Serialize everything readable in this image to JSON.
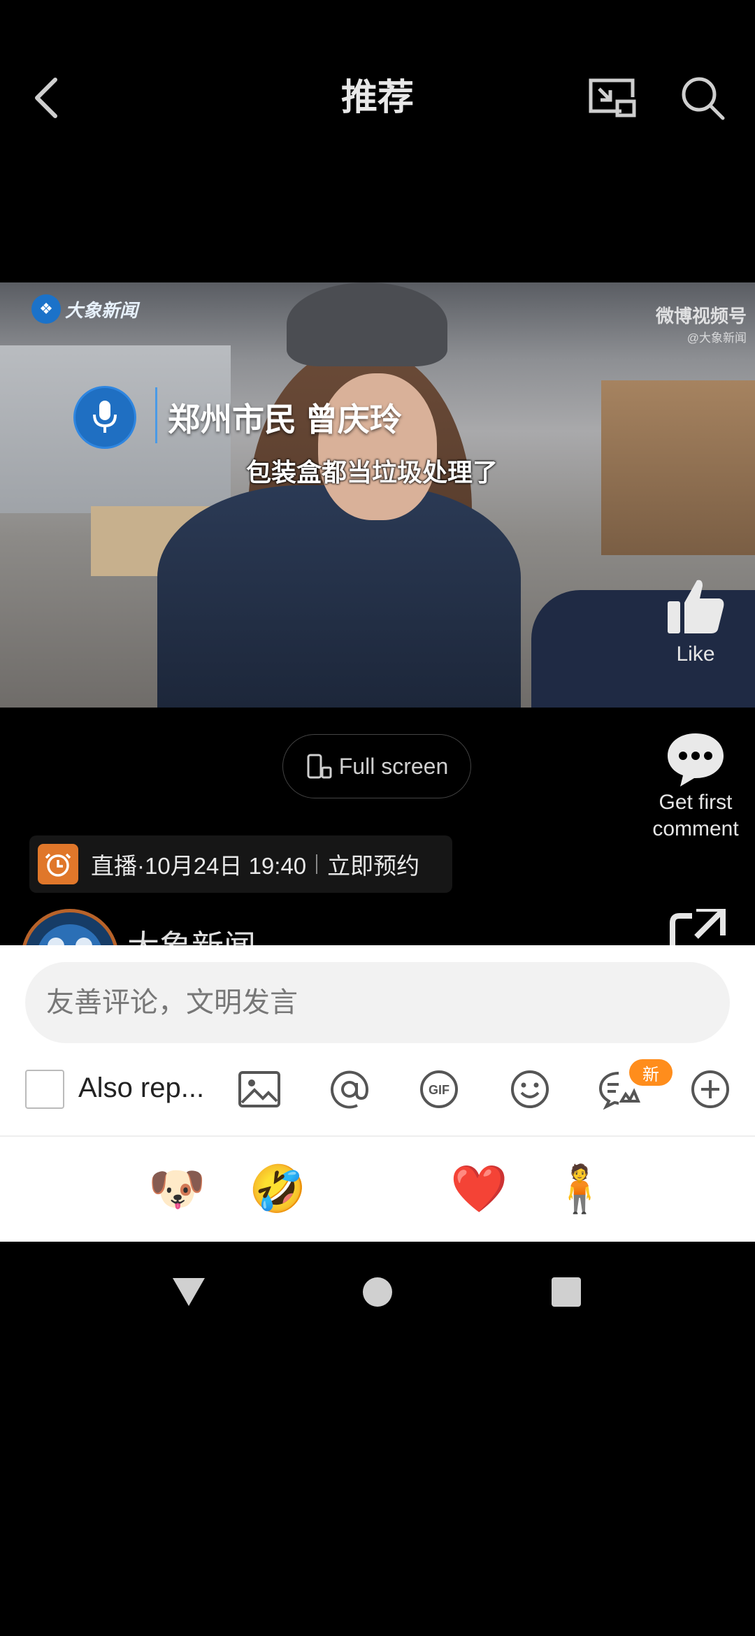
{
  "header": {
    "title": "推荐",
    "icons": [
      "back-arrow-icon",
      "floating-window-icon",
      "search-icon"
    ]
  },
  "video": {
    "logo_text": "大象新闻",
    "watermark_main": "微博视频号",
    "watermark_sub": "@大象新闻",
    "caption_name": "郑州市民 曾庆玲",
    "subtitle": "包装盒都当垃圾处理了",
    "like_label": "Like"
  },
  "actions": {
    "fullscreen_label": "Full screen",
    "comment_label_line1": "Get first",
    "comment_label_line2": "comment"
  },
  "live_banner": {
    "text": "直播·10月24日 19:40",
    "action": "立即预约"
  },
  "author": {
    "name": "大象新闻"
  },
  "comment_sheet": {
    "placeholder": "友善评论，文明发言",
    "input_value": "",
    "repost_label": "Also rep...",
    "repost_checked": false,
    "new_badge": "新",
    "tools": [
      "image-icon",
      "at-icon",
      "gif-icon",
      "emoji-icon",
      "topic-icon",
      "plus-icon"
    ],
    "emojis": [
      "😭",
      "🐶",
      "🤣",
      "😆",
      "❤️",
      "🧍",
      "😂"
    ]
  },
  "colors": {
    "accent_orange": "#ff8d1c",
    "live_clock": "#e0772a",
    "mic_blue": "#1f6fc2"
  }
}
